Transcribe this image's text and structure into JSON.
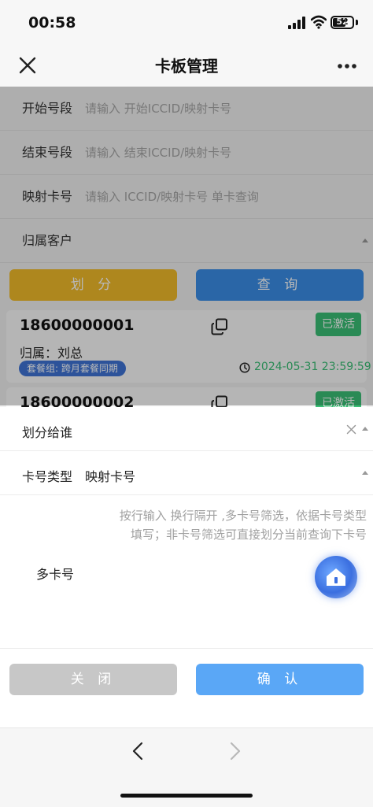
{
  "status_bar": {
    "time": "00:58",
    "battery": "52"
  },
  "navbar": {
    "title": "卡板管理"
  },
  "filters": [
    {
      "label": "开始号段",
      "placeholder": "请输入 开始ICCID/映射卡号"
    },
    {
      "label": "结束号段",
      "placeholder": "请输入 结束ICCID/映射卡号"
    },
    {
      "label": "映射卡号",
      "placeholder": "请输入 ICCID/映射卡号 单卡查询"
    }
  ],
  "customer": {
    "label": "归属客户"
  },
  "actions": {
    "divide": "划 分",
    "query": "查 询"
  },
  "cards": [
    {
      "number": "18600000001",
      "status": "已激活",
      "owner": "归属：刘总",
      "package": "套餐组: 跨月套餐同期",
      "expiry": "2024-05-31 23:59:59"
    },
    {
      "number": "18600000002",
      "status": "已激活"
    }
  ],
  "sheet": {
    "assign_label": "划分给谁",
    "card_type_label": "卡号类型",
    "card_type_value": "映射卡号",
    "placeholder_line1": "按行输入 换行隔开 ,多卡号筛选，依据卡号类型",
    "placeholder_line2": "填写；非卡号筛选可直接划分当前查询下卡号",
    "multi_label": "多卡号",
    "close": "关 闭",
    "confirm": "确 认"
  },
  "colors": {
    "divide": "#f1bb2a",
    "query": "#3b8ee8",
    "active": "#3bbf76",
    "confirm": "#5aa7f6",
    "close": "#c7c7c7",
    "package_badge": "#3f74d6",
    "expiry_text": "#3bbf76"
  }
}
